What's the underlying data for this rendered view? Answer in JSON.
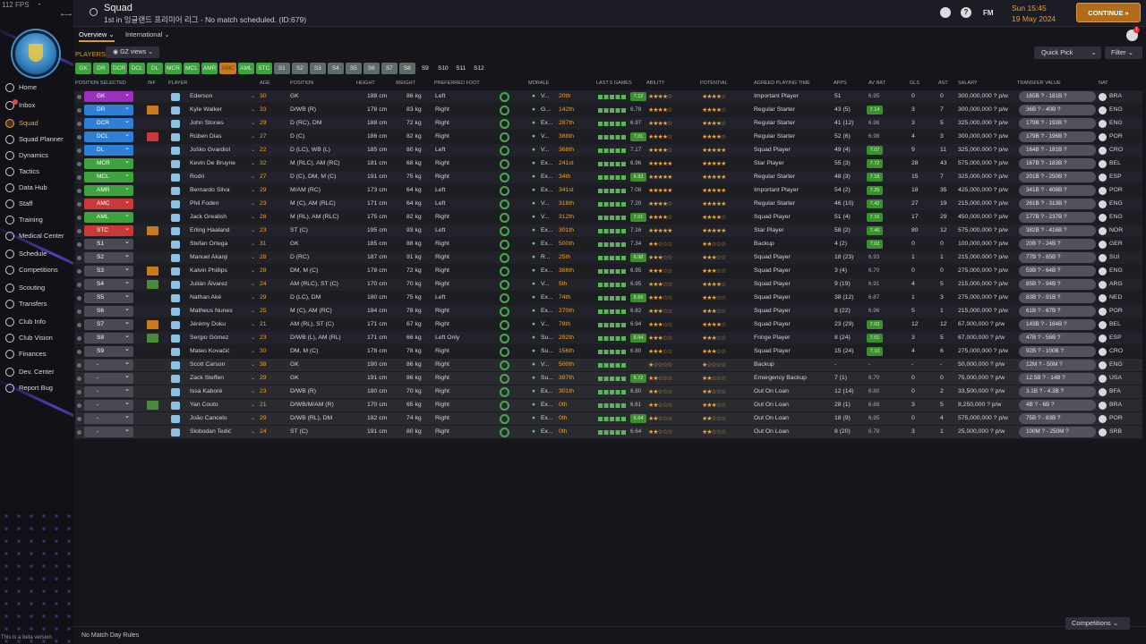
{
  "app": {
    "fps": "112 FPS",
    "title": "Squad",
    "subtitle": "1st in 잉글랜드 프리미어 리그 - No match scheduled. (ID:679)",
    "beta_note": "This is a beta version.",
    "no_match": "No Match Day Rules"
  },
  "topbar": {
    "date_line1": "Sun 15:45",
    "date_line2": "19 May 2024",
    "continue_label": "CONTINUE",
    "fm_label": "FM"
  },
  "subtabs": {
    "overview": "Overview",
    "international": "International"
  },
  "toolbar": {
    "players_label": "PLAYERS",
    "views_label": "GZ views",
    "quick_pick": "Quick Pick",
    "filter": "Filter",
    "competitions": "Competitions"
  },
  "nav": [
    {
      "label": "Home"
    },
    {
      "label": "Inbox"
    },
    {
      "label": "Squad"
    },
    {
      "label": "Squad Planner"
    },
    {
      "label": "Dynamics"
    },
    {
      "label": "Tactics"
    },
    {
      "label": "Data Hub"
    },
    {
      "label": "Staff"
    },
    {
      "label": "Training"
    },
    {
      "label": "Medical Center"
    },
    {
      "label": "Schedule"
    },
    {
      "label": "Competitions"
    },
    {
      "label": "Scouting"
    },
    {
      "label": "Transfers"
    },
    {
      "label": "Club Info"
    },
    {
      "label": "Club Vision"
    },
    {
      "label": "Finances"
    },
    {
      "label": "Dev. Center"
    },
    {
      "label": "Report Bug"
    }
  ],
  "colors": {
    "accent": "#e9a33a",
    "gk": "#9b2fc0",
    "def": "#2e7fd6",
    "mid": "#3ea33e",
    "amc": "#c83a3a",
    "stc": "#c83a3a",
    "sub": "#4a4a55"
  },
  "chips": [
    "GK",
    "DR",
    "DCR",
    "DCL",
    "DL",
    "MCR",
    "MCL",
    "AMR",
    "AMC",
    "AML",
    "STC",
    "S1",
    "S2",
    "S3",
    "S4",
    "S5",
    "S6",
    "S7",
    "S8",
    "S9",
    "S10",
    "S11",
    "S12"
  ],
  "headers": [
    "POSITION SELECTED",
    "INF",
    "PLAYER",
    "AGE",
    "POSITION",
    "HEIGHT",
    "WEIGHT",
    "PREFERRED FOOT",
    "MORALE",
    "LAST 5 GAMES",
    "ABILITY",
    "POTENTIAL",
    "AGREED PLAYING TIME",
    "APPS",
    "AV RAT",
    "GLS",
    "AST",
    "SALARY",
    "TRANSFER VALUE",
    "NAT"
  ],
  "players": [
    {
      "sel": "GK",
      "name": "Ederson",
      "age": "30",
      "pos": "GK",
      "height": "188 cm",
      "weight": "86 kg",
      "foot": "Left",
      "morale": "V...",
      "rank": "20th",
      "rating": "7.12",
      "ability": 4,
      "potential": 4,
      "time": "Important Player",
      "apps": "51",
      "av": "6.95",
      "gls": "0",
      "ast": "0",
      "salary": "300,000,000 ? p/w",
      "tv": "165B ? - 181B ?",
      "nat": "BRA"
    },
    {
      "sel": "DR",
      "name": "Kyle Walker",
      "age": "33",
      "pos": "D/WB (R)",
      "height": "178 cm",
      "weight": "83 kg",
      "foot": "Right",
      "morale": "G...",
      "rank": "142th",
      "rating": "6.78",
      "ability": 4,
      "potential": 4,
      "time": "Regular Starter",
      "apps": "43 (5)",
      "av": "7.14",
      "gls": "3",
      "ast": "7",
      "salary": "300,000,000 ? p/w",
      "tv": "36B ? - 40B ?",
      "nat": "ENG"
    },
    {
      "sel": "DCR",
      "name": "John Stones",
      "age": "29",
      "pos": "D (RC), DM",
      "height": "188 cm",
      "weight": "72 kg",
      "foot": "Right",
      "morale": "Ex...",
      "rank": "287th",
      "rating": "6.97",
      "ability": 4,
      "potential": 4,
      "time": "Regular Starter",
      "apps": "41 (12)",
      "av": "6.98",
      "gls": "3",
      "ast": "5",
      "salary": "325,000,000 ? p/w",
      "tv": "179B ? - 193B ?",
      "nat": "ENG"
    },
    {
      "sel": "DCL",
      "name": "Rúben Dias",
      "age": "27",
      "pos": "D (C)",
      "height": "186 cm",
      "weight": "82 kg",
      "foot": "Right",
      "morale": "V...",
      "rank": "388th",
      "rating": "7.01",
      "ability": 4,
      "potential": 4,
      "time": "Regular Starter",
      "apps": "52 (6)",
      "av": "6.98",
      "gls": "4",
      "ast": "3",
      "salary": "300,000,000 ? p/w",
      "tv": "179B ? - 196B ?",
      "nat": "POR"
    },
    {
      "sel": "DL",
      "name": "Joško Gvardiol",
      "age": "22",
      "pos": "D (LC), WB (L)",
      "height": "185 cm",
      "weight": "80 kg",
      "foot": "Left",
      "morale": "V...",
      "rank": "368th",
      "rating": "7.17",
      "ability": 4,
      "potential": 5,
      "time": "Squad Player",
      "apps": "49 (4)",
      "av": "7.07",
      "gls": "9",
      "ast": "11",
      "salary": "325,000,000 ? p/w",
      "tv": "164B ? - 181B ?",
      "nat": "CRO"
    },
    {
      "sel": "MCR",
      "name": "Kevin De Bruyne",
      "age": "32",
      "pos": "M (RLC), AM (RC)",
      "height": "181 cm",
      "weight": "68 kg",
      "foot": "Right",
      "morale": "Ex...",
      "rank": "241st",
      "rating": "6.96",
      "ability": 5,
      "potential": 5,
      "time": "Star Player",
      "apps": "55 (3)",
      "av": "7.72",
      "gls": "28",
      "ast": "43",
      "salary": "575,000,000 ? p/w",
      "tv": "167B ? - 183B ?",
      "nat": "BEL"
    },
    {
      "sel": "MCL",
      "name": "Rodri",
      "age": "27",
      "pos": "D (C), DM, M (C)",
      "height": "191 cm",
      "weight": "75 kg",
      "foot": "Right",
      "morale": "Ex...",
      "rank": "34th",
      "rating": "6.93",
      "ability": 5,
      "potential": 5,
      "time": "Regular Starter",
      "apps": "48 (3)",
      "av": "7.18",
      "gls": "15",
      "ast": "7",
      "salary": "325,000,000 ? p/w",
      "tv": "201B ? - 250B ?",
      "nat": "ESP"
    },
    {
      "sel": "AMR",
      "name": "Bernardo Silva",
      "age": "29",
      "pos": "M/AM (RC)",
      "height": "173 cm",
      "weight": "64 kg",
      "foot": "Left",
      "morale": "Ex...",
      "rank": "341st",
      "rating": "7.08",
      "ability": 5,
      "potential": 5,
      "time": "Important Player",
      "apps": "54 (2)",
      "av": "7.25",
      "gls": "18",
      "ast": "35",
      "salary": "425,000,000 ? p/w",
      "tv": "341B ? - 408B ?",
      "nat": "POR"
    },
    {
      "sel": "AMC",
      "name": "Phil Foden",
      "age": "23",
      "pos": "M (C), AM (RLC)",
      "height": "171 cm",
      "weight": "64 kg",
      "foot": "Left",
      "morale": "V...",
      "rank": "316th",
      "rating": "7.20",
      "ability": 4,
      "potential": 5,
      "time": "Regular Starter",
      "apps": "46 (10)",
      "av": "7.42",
      "gls": "27",
      "ast": "19",
      "salary": "215,000,000 ? p/w",
      "tv": "261B ? - 313B ?",
      "nat": "ENG"
    },
    {
      "sel": "AML",
      "name": "Jack Grealish",
      "age": "28",
      "pos": "M (RL), AM (RLC)",
      "height": "175 cm",
      "weight": "82 kg",
      "foot": "Right",
      "morale": "V...",
      "rank": "312th",
      "rating": "7.01",
      "ability": 4,
      "potential": 4,
      "time": "Squad Player",
      "apps": "51 (4)",
      "av": "7.16",
      "gls": "17",
      "ast": "29",
      "salary": "450,000,000 ? p/w",
      "tv": "177B ? - 237B ?",
      "nat": "ENG"
    },
    {
      "sel": "STC",
      "name": "Erling Haaland",
      "age": "23",
      "pos": "ST (C)",
      "height": "195 cm",
      "weight": "93 kg",
      "foot": "Left",
      "morale": "Ex...",
      "rank": "301th",
      "rating": "7.16",
      "ability": 5,
      "potential": 5,
      "time": "Star Player",
      "apps": "58 (2)",
      "av": "7.46",
      "gls": "80",
      "ast": "12",
      "salary": "575,000,000 ? p/w",
      "tv": "382B ? - 416B ?",
      "nat": "NOR"
    },
    {
      "sel": "S1",
      "name": "Stefan Ortega",
      "age": "31",
      "pos": "GK",
      "height": "185 cm",
      "weight": "88 kg",
      "foot": "Right",
      "morale": "Ex...",
      "rank": "500th",
      "rating": "7.34",
      "ability": 2,
      "potential": 2,
      "time": "Backup",
      "apps": "4 (2)",
      "av": "7.02",
      "gls": "0",
      "ast": "0",
      "salary": "100,000,000 ? p/w",
      "tv": "20B ? - 24B ?",
      "nat": "GER"
    },
    {
      "sel": "S2",
      "name": "Manuel Akanji",
      "age": "28",
      "pos": "D (RC)",
      "height": "187 cm",
      "weight": "91 kg",
      "foot": "Right",
      "morale": "R...",
      "rank": "25th",
      "rating": "6.98",
      "ability": 3,
      "potential": 3,
      "time": "Squad Player",
      "apps": "18 (23)",
      "av": "6.93",
      "gls": "1",
      "ast": "1",
      "salary": "215,000,000 ? p/w",
      "tv": "77B ? - 85B ?",
      "nat": "SUI"
    },
    {
      "sel": "S3",
      "name": "Kalvin Phillips",
      "age": "28",
      "pos": "DM, M (C)",
      "height": "178 cm",
      "weight": "72 kg",
      "foot": "Right",
      "morale": "Ex...",
      "rank": "386th",
      "rating": "6.95",
      "ability": 3,
      "potential": 3,
      "time": "Squad Player",
      "apps": "3 (4)",
      "av": "6.70",
      "gls": "0",
      "ast": "0",
      "salary": "275,000,000 ? p/w",
      "tv": "59B ? - 64B ?",
      "nat": "ENG"
    },
    {
      "sel": "S4",
      "name": "Julián Álvarez",
      "age": "24",
      "pos": "AM (RLC), ST (C)",
      "height": "170 cm",
      "weight": "70 kg",
      "foot": "Right",
      "morale": "V...",
      "rank": "5th",
      "rating": "6.95",
      "ability": 3,
      "potential": 4,
      "time": "Squad Player",
      "apps": "9 (19)",
      "av": "6.91",
      "gls": "4",
      "ast": "5",
      "salary": "215,000,000 ? p/w",
      "tv": "85B ? - 94B ?",
      "nat": "ARG"
    },
    {
      "sel": "S5",
      "name": "Nathan Aké",
      "age": "29",
      "pos": "D (LC), DM",
      "height": "180 cm",
      "weight": "75 kg",
      "foot": "Left",
      "morale": "Ex...",
      "rank": "74th",
      "rating": "6.66",
      "ability": 3,
      "potential": 3,
      "time": "Squad Player",
      "apps": "38 (12)",
      "av": "6.87",
      "gls": "1",
      "ast": "3",
      "salary": "275,000,000 ? p/w",
      "tv": "83B ? - 91B ?",
      "nat": "NED"
    },
    {
      "sel": "S6",
      "name": "Matheus Nunes",
      "age": "25",
      "pos": "M (C), AM (RC)",
      "height": "184 cm",
      "weight": "78 kg",
      "foot": "Right",
      "morale": "Ex...",
      "rank": "270th",
      "rating": "6.82",
      "ability": 3,
      "potential": 3,
      "time": "Squad Player",
      "apps": "8 (22)",
      "av": "6.96",
      "gls": "5",
      "ast": "1",
      "salary": "215,000,000 ? p/w",
      "tv": "61B ? - 67B ?",
      "nat": "POR"
    },
    {
      "sel": "S7",
      "name": "Jérémy Doku",
      "age": "21",
      "pos": "AM (RL), ST (C)",
      "height": "171 cm",
      "weight": "67 kg",
      "foot": "Right",
      "morale": "V...",
      "rank": "78th",
      "rating": "6.94",
      "ability": 3,
      "potential": 4,
      "time": "Squad Player",
      "apps": "23 (29)",
      "av": "7.03",
      "gls": "12",
      "ast": "12",
      "salary": "67,000,000 ? p/w",
      "tv": "143B ? - 164B ?",
      "nat": "BEL"
    },
    {
      "sel": "S8",
      "name": "Sergio Gómez",
      "age": "23",
      "pos": "D/WB (L), AM (RL)",
      "height": "171 cm",
      "weight": "66 kg",
      "foot": "Left Only",
      "morale": "Su...",
      "rank": "292th",
      "rating": "6.94",
      "ability": 3,
      "potential": 3,
      "time": "Fringe Player",
      "apps": "8 (24)",
      "av": "7.01",
      "gls": "3",
      "ast": "5",
      "salary": "67,000,000 ? p/w",
      "tv": "47B ? - 56B ?",
      "nat": "ESP"
    },
    {
      "sel": "S9",
      "name": "Mateo Kovačić",
      "age": "30",
      "pos": "DM, M (C)",
      "height": "178 cm",
      "weight": "78 kg",
      "foot": "Right",
      "morale": "Su...",
      "rank": "156th",
      "rating": "6.80",
      "ability": 3,
      "potential": 3,
      "time": "Squad Player",
      "apps": "15 (24)",
      "av": "7.10",
      "gls": "4",
      "ast": "6",
      "salary": "275,000,000 ? p/w",
      "tv": "92B ? - 100B ?",
      "nat": "CRO"
    },
    {
      "sel": "-",
      "name": "Scott Carson",
      "age": "38",
      "pos": "GK",
      "height": "190 cm",
      "weight": "86 kg",
      "foot": "Right",
      "morale": "V...",
      "rank": "500th",
      "rating": "",
      "ability": 1,
      "potential": 1,
      "time": "Backup",
      "apps": "-",
      "av": "-",
      "gls": "-",
      "ast": "-",
      "salary": "50,000,000 ? p/w",
      "tv": "12M ? - 50M ?",
      "nat": "ENG"
    },
    {
      "sel": "-",
      "name": "Zack Steffen",
      "age": "29",
      "pos": "GK",
      "height": "191 cm",
      "weight": "86 kg",
      "foot": "Right",
      "morale": "Su...",
      "rank": "397th",
      "rating": "6.72",
      "ability": 2,
      "potential": 2,
      "time": "Emergency Backup",
      "apps": "7 (1)",
      "av": "6.70",
      "gls": "0",
      "ast": "0",
      "salary": "75,000,000 ? p/w",
      "tv": "12.5B ? - 14B ?",
      "nat": "USA"
    },
    {
      "sel": "-",
      "name": "Issa Kaboré",
      "age": "23",
      "pos": "D/WB (R)",
      "height": "180 cm",
      "weight": "70 kg",
      "foot": "Right",
      "morale": "Ex...",
      "rank": "301th",
      "rating": "6.80",
      "ability": 2,
      "potential": 2,
      "time": "Out On Loan",
      "apps": "12 (14)",
      "av": "6.80",
      "gls": "0",
      "ast": "2",
      "salary": "33,500,000 ? p/w",
      "tv": "3.1B ? - 4.3B ?",
      "nat": "BFA"
    },
    {
      "sel": "-",
      "name": "Yan Couto",
      "age": "21",
      "pos": "D/WB/M/AM (R)",
      "height": "170 cm",
      "weight": "65 kg",
      "foot": "Right",
      "morale": "Ex...",
      "rank": "0th",
      "rating": "6.61",
      "ability": 2,
      "potential": 3,
      "time": "Out On Loan",
      "apps": "28 (1)",
      "av": "6.88",
      "gls": "3",
      "ast": "5",
      "salary": "8,250,000 ? p/w",
      "tv": "4B ? - 6B ?",
      "nat": "BRA"
    },
    {
      "sel": "-",
      "name": "João Cancelo",
      "age": "29",
      "pos": "D/WB (RL), DM",
      "height": "182 cm",
      "weight": "74 kg",
      "foot": "Right",
      "morale": "Ex...",
      "rank": "0th",
      "rating": "6.64",
      "ability": 2,
      "potential": 2,
      "time": "Out On Loan",
      "apps": "18 (9)",
      "av": "6.95",
      "gls": "0",
      "ast": "4",
      "salary": "575,000,000 ? p/w",
      "tv": "75B ? - 83B ?",
      "nat": "POR"
    },
    {
      "sel": "-",
      "name": "Slobodan Tedić",
      "age": "24",
      "pos": "ST (C)",
      "height": "191 cm",
      "weight": "80 kg",
      "foot": "Right",
      "morale": "Ex...",
      "rank": "0th",
      "rating": "6.64",
      "ability": 2,
      "potential": 2,
      "time": "Out On Loan",
      "apps": "8 (20)",
      "av": "6.78",
      "gls": "3",
      "ast": "1",
      "salary": "25,000,000 ? p/w",
      "tv": "100M ? - 250M ?",
      "nat": "SRB"
    }
  ]
}
